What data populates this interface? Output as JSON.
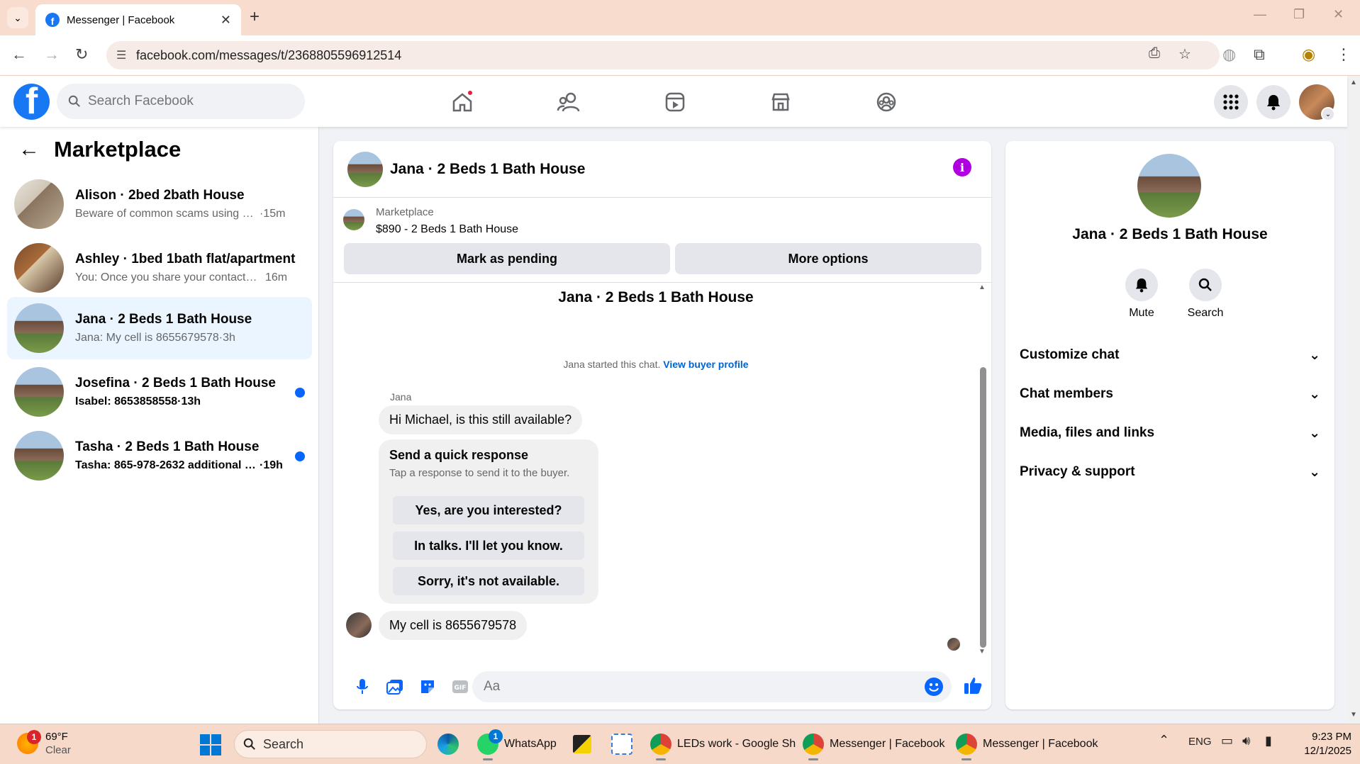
{
  "browser": {
    "tab_title": "Messenger | Facebook",
    "url": "facebook.com/messages/t/2368805596912514"
  },
  "fbnav": {
    "search_placeholder": "Search Facebook"
  },
  "sidebar": {
    "title": "Marketplace",
    "conversations": [
      {
        "name": "Alison · 2bed 2bath House",
        "preview": "Beware of common scams using pa...",
        "time": "·15m",
        "unread": false,
        "active": false
      },
      {
        "name": "Ashley · 1bed 1bath flat/apartment",
        "preview": "You: Once you share your contact n...",
        "time": "16m",
        "unread": false,
        "active": false
      },
      {
        "name": "Jana · 2 Beds 1 Bath House",
        "preview": "Jana: My cell is 8655679578",
        "time": "·3h",
        "unread": false,
        "active": true
      },
      {
        "name": "Josefina · 2 Beds 1 Bath House",
        "preview": "Isabel: 8653858558",
        "time": "·13h",
        "unread": true,
        "active": false
      },
      {
        "name": "Tasha · 2 Beds 1 Bath House",
        "preview": "Tasha: 865-978-2632 additional n...",
        "time": "·19h",
        "unread": true,
        "active": false
      }
    ]
  },
  "chat": {
    "header_name": "Jana · 2 Beds 1 Bath House",
    "listing_label": "Marketplace",
    "listing_price": "$890 - 2 Beds 1 Bath House",
    "mark_pending": "Mark as pending",
    "more_options": "More options",
    "thread_title": "Jana · 2 Beds 1 Bath House",
    "started_text": "Jana started this chat.",
    "view_profile": "View buyer profile",
    "sender": "Jana",
    "message1": "Hi Michael, is this still available?",
    "quick_title": "Send a quick response",
    "quick_sub": "Tap a response to send it to the buyer.",
    "quick_replies": [
      "Yes, are you interested?",
      "In talks. I'll let you know.",
      "Sorry, it's not available."
    ],
    "message2": "My cell is 8655679578",
    "composer_placeholder": "Aa"
  },
  "details": {
    "name": "Jana · 2 Beds 1 Bath House",
    "mute": "Mute",
    "search": "Search",
    "rows": [
      "Customize chat",
      "Chat members",
      "Media, files and links",
      "Privacy & support"
    ]
  },
  "taskbar": {
    "weather_badge": "1",
    "temp": "69°F",
    "condition": "Clear",
    "search": "Search",
    "whatsapp": "WhatsApp",
    "whatsapp_badge": "1",
    "sheets": "LEDs work - Google Sh",
    "messenger1": "Messenger | Facebook",
    "messenger2": "Messenger | Facebook",
    "lang": "ENG",
    "time": "9:23 PM",
    "date": "12/1/2025"
  },
  "colors": {
    "fb_blue": "#1877f2",
    "unread_blue": "#0866ff",
    "info_purple": "#b000e0",
    "active_bg": "#ebf5ff"
  }
}
